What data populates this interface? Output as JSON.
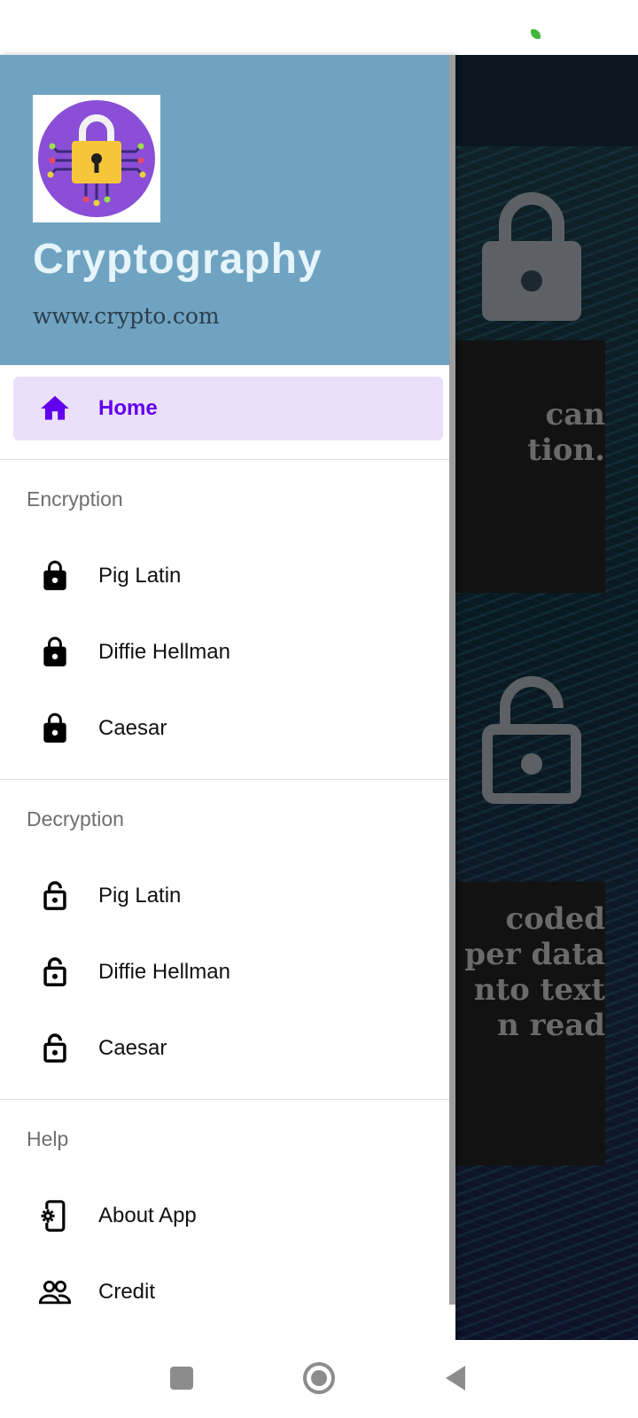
{
  "status_bar": {
    "indicator_color": "#44b53b"
  },
  "background_app": {
    "cards": [
      {
        "lines": [
          "",
          "can",
          "tion."
        ]
      },
      {
        "lines": [
          "coded",
          "per data",
          "nto text",
          "n read"
        ]
      }
    ]
  },
  "drawer": {
    "header": {
      "logo_icon": "padlock-circuit-icon",
      "title": "Cryptography",
      "website": "www.crypto.com"
    },
    "home": {
      "label": "Home",
      "icon": "home-icon",
      "active": true
    },
    "sections": [
      {
        "title": "Encryption",
        "items": [
          {
            "label": "Pig Latin",
            "icon": "lock-icon"
          },
          {
            "label": "Diffie Hellman",
            "icon": "lock-icon"
          },
          {
            "label": "Caesar",
            "icon": "lock-icon"
          }
        ]
      },
      {
        "title": "Decryption",
        "items": [
          {
            "label": "Pig Latin",
            "icon": "lock-open-icon"
          },
          {
            "label": "Diffie Hellman",
            "icon": "lock-open-icon"
          },
          {
            "label": "Caesar",
            "icon": "lock-open-icon"
          }
        ]
      },
      {
        "title": "Help",
        "items": [
          {
            "label": "About App",
            "icon": "phone-settings-icon"
          },
          {
            "label": "Credit",
            "icon": "people-icon"
          }
        ]
      }
    ]
  },
  "colors": {
    "header_background": "#6fa3c1",
    "accent": "#6200ee",
    "active_item_background": "#ebe0fa"
  },
  "system_nav": {
    "recents": "recents-icon",
    "home": "home-circle-icon",
    "back": "back-icon"
  }
}
